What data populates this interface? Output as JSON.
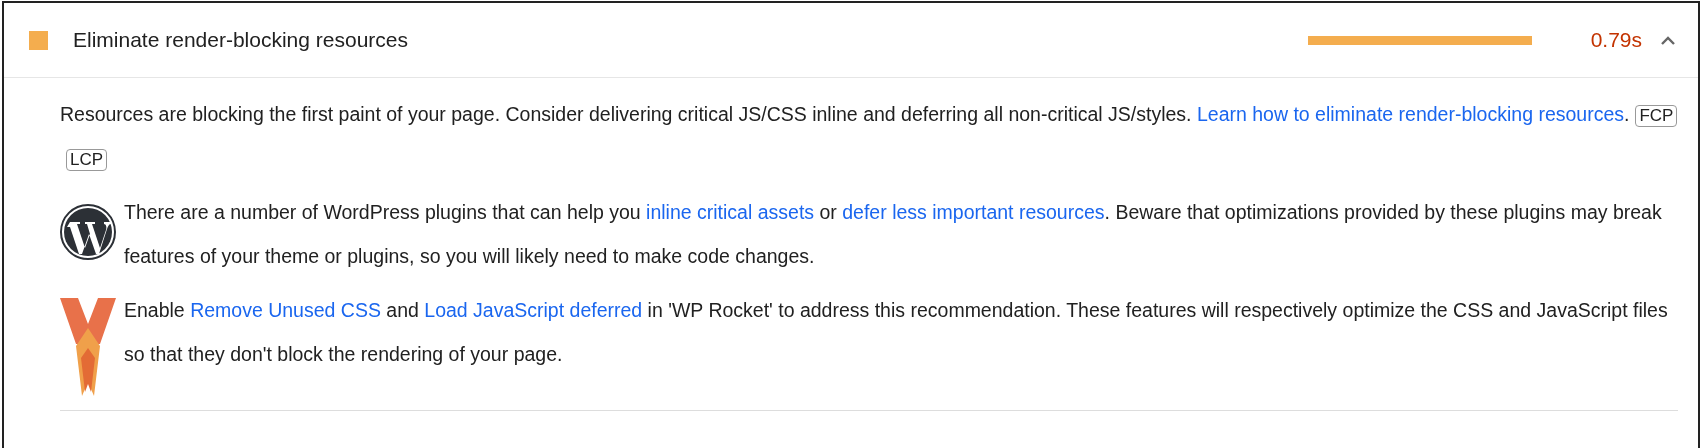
{
  "audit": {
    "title": "Eliminate render-blocking resources",
    "color": "#f4ad4e",
    "value": "0.79s",
    "expanded": true,
    "description": [
      {
        "kind": "text",
        "text": "Resources are blocking the first paint of your page. Consider delivering critical JS/CSS inline and deferring all non-critical JS/styles. "
      },
      {
        "kind": "link",
        "text": "Learn how to eliminate render-blocking resources"
      },
      {
        "kind": "text",
        "text": "."
      }
    ],
    "badges": [
      "FCP",
      "LCP"
    ],
    "notes": [
      {
        "kind": "wordpress",
        "parts": [
          {
            "kind": "text",
            "text": "There are a number of WordPress plugins that can help you "
          },
          {
            "kind": "link",
            "text": "inline critical assets"
          },
          {
            "kind": "text",
            "text": " or "
          },
          {
            "kind": "link",
            "text": "defer less important resources"
          },
          {
            "kind": "text",
            "text": ". Beware that optimizations provided by these plugins may break features of your theme or plugins, so you will likely need to make code changes."
          }
        ]
      },
      {
        "kind": "rocket",
        "parts": [
          {
            "kind": "text",
            "text": "Enable "
          },
          {
            "kind": "link",
            "text": "Remove Unused CSS"
          },
          {
            "kind": "text",
            "text": " and "
          },
          {
            "kind": "link",
            "text": "Load JavaScript deferred"
          },
          {
            "kind": "text",
            "text": " in 'WP Rocket' to address this recommendation. These features will respectively optimize the CSS and JavaScript files so that they don't block the rendering of your page."
          }
        ]
      }
    ]
  }
}
